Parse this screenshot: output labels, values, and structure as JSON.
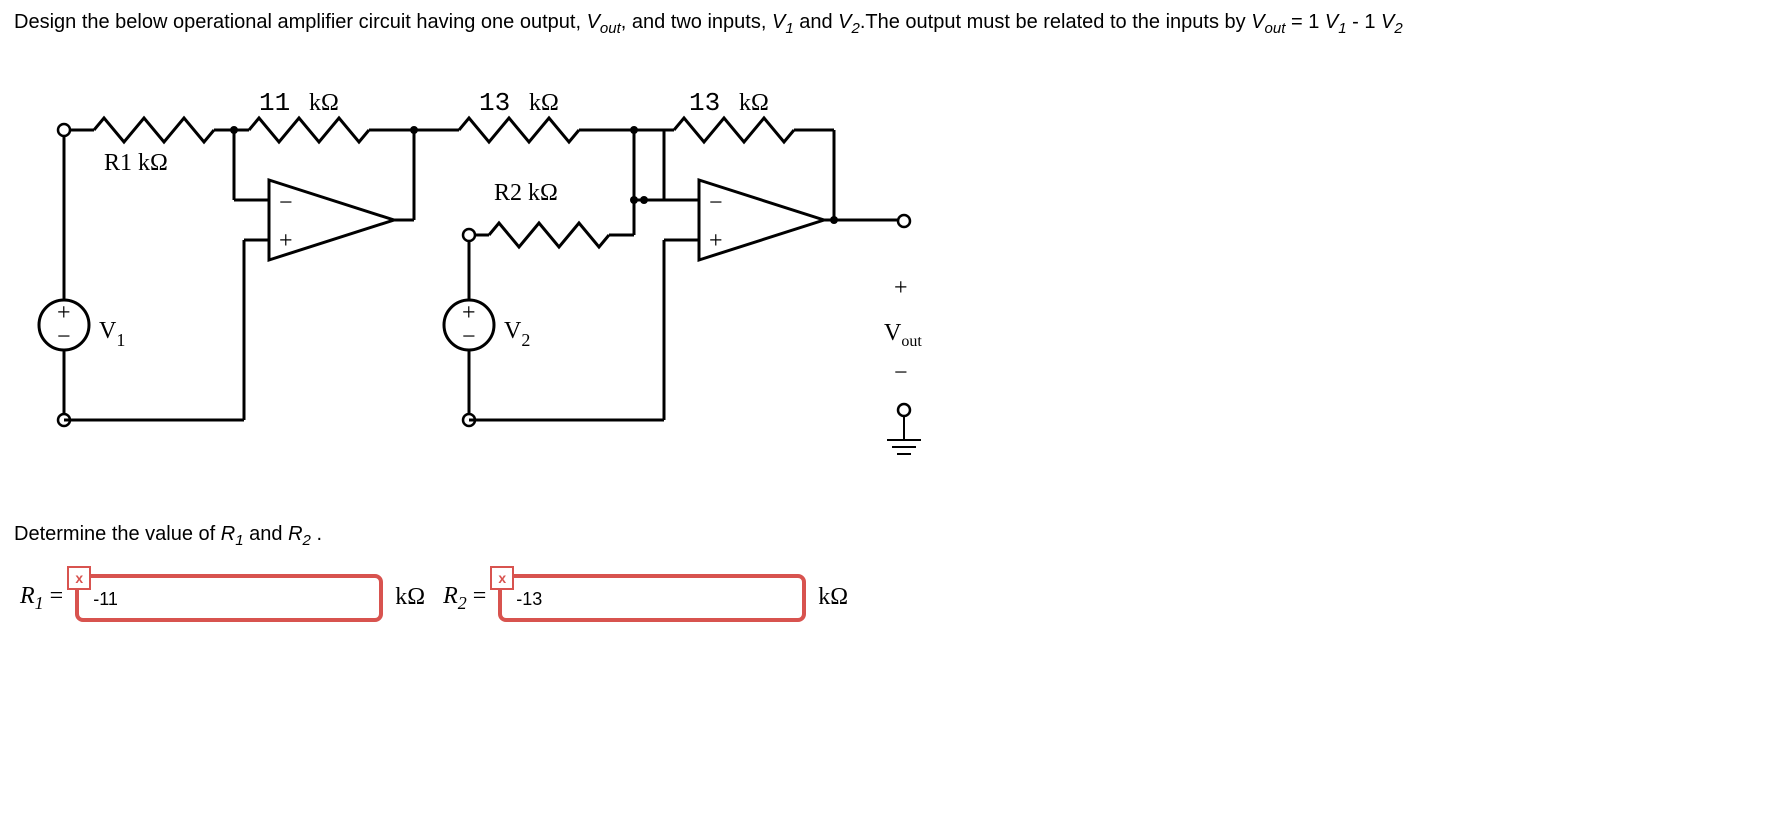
{
  "question": {
    "line1a": "Design the below operational amplifier circuit having one output, ",
    "vout_var": "V",
    "vout_sub": "out",
    "line1b": ", and two inputs, ",
    "v1_var": "V",
    "v1_sub": "1",
    "line1c": " and ",
    "v2_var": "V",
    "v2_sub": "2",
    "line1d": ".The output must be related to the inputs by ",
    "eq_lhs_var": "V",
    "eq_lhs_sub": "out",
    "eq_mid": " = 1 ",
    "eq_v1_var": "V",
    "eq_v1_sub": "1",
    "eq_minus": " - 1 ",
    "eq_v2_var": "V",
    "eq_v2_sub": "2"
  },
  "circuit": {
    "r_top1_val": "11",
    "r_top1_unit": "kΩ",
    "r_top2_val": "13",
    "r_top2_unit": "kΩ",
    "r_top3_val": "13",
    "r_top3_unit": "kΩ",
    "r1_label": "R1  kΩ",
    "r2_label": "R2  kΩ",
    "v1_label": "V",
    "v1_sub": "1",
    "v2_label": "V",
    "v2_sub": "2",
    "vout_label": "V",
    "vout_sub": "out",
    "plus": "+",
    "minus": "−",
    "terminal_plus": "+",
    "terminal_minus": "−"
  },
  "prompt2": {
    "pre": "Determine the value of ",
    "r1_var": "R",
    "r1_sub": "1",
    "and": " and ",
    "r2_var": "R",
    "r2_sub": "2",
    "post": "."
  },
  "answers": {
    "r1_label_var": "R",
    "r1_label_sub": "1",
    "equals": " = ",
    "r1_value": "-11",
    "r1_unit": "kΩ ",
    "r2_label_var": "R",
    "r2_label_sub": "2",
    "r2_value": "-13",
    "r2_unit": "kΩ",
    "badge": "x"
  }
}
